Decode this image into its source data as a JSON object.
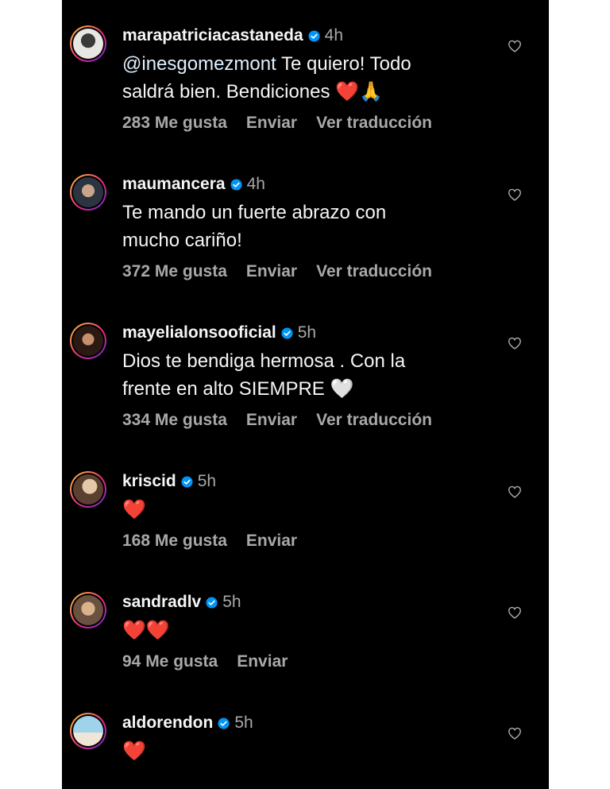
{
  "colors": {
    "background": "#000000",
    "text": "#f5f5f5",
    "muted": "#a8a8a8",
    "verified": "#0095f6",
    "heart_red": "#e0243b"
  },
  "comments": [
    {
      "username": "marapatriciacastaneda",
      "time": "4h",
      "mention": "@inesgomezmont",
      "text_line1": " Te quiero! Todo",
      "text_line2": "saldrá bien. Bendiciones ❤️🙏",
      "likes": "283 Me gusta",
      "reply": "Enviar",
      "translate": "Ver traducción"
    },
    {
      "username": "maumancera",
      "time": "4h",
      "text_line1": "Te mando un fuerte abrazo con",
      "text_line2": "mucho cariño!",
      "likes": "372 Me gusta",
      "reply": "Enviar",
      "translate": "Ver traducción"
    },
    {
      "username": "mayelialonsooficial",
      "time": "5h",
      "text_line1": "Dios te bendiga hermosa . Con la",
      "text_line2": "frente en alto SIEMPRE 🤍",
      "likes": "334 Me gusta",
      "reply": "Enviar",
      "translate": "Ver traducción"
    },
    {
      "username": "kriscid",
      "time": "5h",
      "text_line1": "❤️",
      "likes": "168 Me gusta",
      "reply": "Enviar"
    },
    {
      "username": "sandradlv",
      "time": "5h",
      "text_line1": "❤️❤️",
      "likes": "94 Me gusta",
      "reply": "Enviar"
    },
    {
      "username": "aldorendon",
      "time": "5h",
      "text_line1": "❤️"
    }
  ]
}
